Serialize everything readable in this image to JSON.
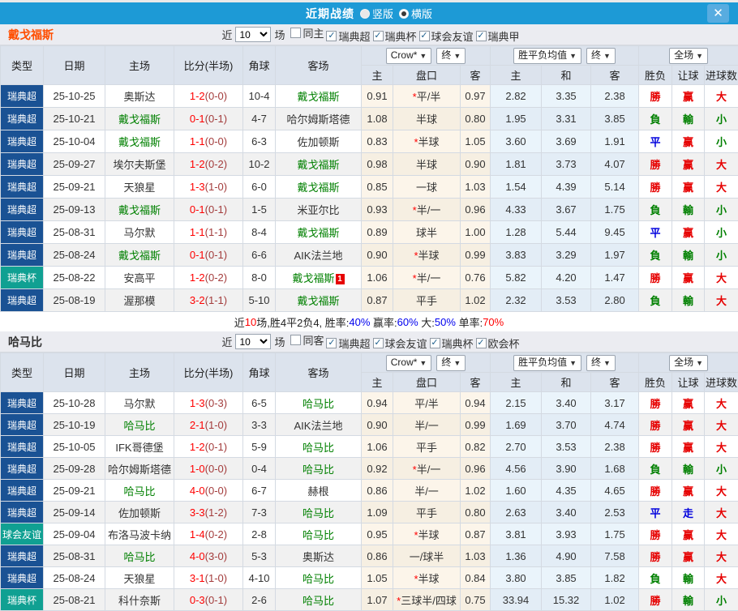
{
  "icons": {
    "close": "✕",
    "dropdown_arrow": "▼",
    "checkmark": "✓"
  },
  "header": {
    "title": "近期战绩",
    "view_options": [
      {
        "label": "竖版",
        "selected": false
      },
      {
        "label": "横版",
        "selected": true
      }
    ]
  },
  "table_header": {
    "main": [
      "类型",
      "日期",
      "主场",
      "比分(半场)",
      "角球",
      "客场"
    ],
    "sub": [
      "主",
      "盘口",
      "客",
      "主",
      "和",
      "客",
      "胜负",
      "让球",
      "进球数"
    ],
    "company": "Crow*",
    "final1": "终",
    "europe": "胜平负均值",
    "final2": "终",
    "scope": "全场"
  },
  "result_color_map": {
    "勝": "r",
    "赢": "r",
    "大": "r",
    "負": "g",
    "輸": "g",
    "小": "g",
    "平": "b",
    "走": "b"
  },
  "sections": [
    {
      "team": "戴戈福斯",
      "team_color": "#ff4e00",
      "near_label": "近",
      "count": "10",
      "games_label": "场",
      "filters": [
        {
          "label": "同主",
          "checked": false
        },
        {
          "label": "瑞典超",
          "checked": true
        },
        {
          "label": "瑞典杯",
          "checked": true
        },
        {
          "label": "球会友谊",
          "checked": true
        },
        {
          "label": "瑞典甲",
          "checked": true
        }
      ],
      "rows": [
        {
          "type": "瑞典超",
          "cup": false,
          "date": "25-10-25",
          "home": "奥斯达",
          "home_hl": false,
          "ft": "1-2",
          "ht": "0-0",
          "corners": "10-4",
          "away": "戴戈福斯",
          "away_hl": true,
          "badge": "",
          "asia": [
            "0.91",
            "*平/半",
            "0.97"
          ],
          "euro": [
            "2.82",
            "3.35",
            "2.38"
          ],
          "res": [
            "勝",
            "赢",
            "大"
          ]
        },
        {
          "type": "瑞典超",
          "cup": false,
          "date": "25-10-21",
          "home": "戴戈福斯",
          "home_hl": true,
          "ft": "0-1",
          "ht": "0-1",
          "corners": "4-7",
          "away": "哈尔姆斯塔德",
          "away_hl": false,
          "badge": "",
          "asia": [
            "1.08",
            "半球",
            "0.80"
          ],
          "euro": [
            "1.95",
            "3.31",
            "3.85"
          ],
          "res": [
            "負",
            "輸",
            "小"
          ]
        },
        {
          "type": "瑞典超",
          "cup": false,
          "date": "25-10-04",
          "home": "戴戈福斯",
          "home_hl": true,
          "ft": "1-1",
          "ht": "0-0",
          "corners": "6-3",
          "away": "佐加顿斯",
          "away_hl": false,
          "badge": "",
          "asia": [
            "0.83",
            "*半球",
            "1.05"
          ],
          "euro": [
            "3.60",
            "3.69",
            "1.91"
          ],
          "res": [
            "平",
            "赢",
            "小"
          ]
        },
        {
          "type": "瑞典超",
          "cup": false,
          "date": "25-09-27",
          "home": "埃尔夫斯堡",
          "home_hl": false,
          "ft": "1-2",
          "ht": "0-2",
          "corners": "10-2",
          "away": "戴戈福斯",
          "away_hl": true,
          "badge": "",
          "asia": [
            "0.98",
            "半球",
            "0.90"
          ],
          "euro": [
            "1.81",
            "3.73",
            "4.07"
          ],
          "res": [
            "勝",
            "赢",
            "大"
          ]
        },
        {
          "type": "瑞典超",
          "cup": false,
          "date": "25-09-21",
          "home": "天狼星",
          "home_hl": false,
          "ft": "1-3",
          "ht": "1-0",
          "corners": "6-0",
          "away": "戴戈福斯",
          "away_hl": true,
          "badge": "",
          "asia": [
            "0.85",
            "一球",
            "1.03"
          ],
          "euro": [
            "1.54",
            "4.39",
            "5.14"
          ],
          "res": [
            "勝",
            "赢",
            "大"
          ]
        },
        {
          "type": "瑞典超",
          "cup": false,
          "date": "25-09-13",
          "home": "戴戈福斯",
          "home_hl": true,
          "ft": "0-1",
          "ht": "0-1",
          "corners": "1-5",
          "away": "米亚尔比",
          "away_hl": false,
          "badge": "",
          "asia": [
            "0.93",
            "*半/一",
            "0.96"
          ],
          "euro": [
            "4.33",
            "3.67",
            "1.75"
          ],
          "res": [
            "負",
            "輸",
            "小"
          ]
        },
        {
          "type": "瑞典超",
          "cup": false,
          "date": "25-08-31",
          "home": "马尔默",
          "home_hl": false,
          "ft": "1-1",
          "ht": "1-1",
          "corners": "8-4",
          "away": "戴戈福斯",
          "away_hl": true,
          "badge": "",
          "asia": [
            "0.89",
            "球半",
            "1.00"
          ],
          "euro": [
            "1.28",
            "5.44",
            "9.45"
          ],
          "res": [
            "平",
            "赢",
            "小"
          ]
        },
        {
          "type": "瑞典超",
          "cup": false,
          "date": "25-08-24",
          "home": "戴戈福斯",
          "home_hl": true,
          "ft": "0-1",
          "ht": "0-1",
          "corners": "6-6",
          "away": "AIK法兰地",
          "away_hl": false,
          "badge": "",
          "asia": [
            "0.90",
            "*半球",
            "0.99"
          ],
          "euro": [
            "3.83",
            "3.29",
            "1.97"
          ],
          "res": [
            "負",
            "輸",
            "小"
          ]
        },
        {
          "type": "瑞典杯",
          "cup": true,
          "date": "25-08-22",
          "home": "安高平",
          "home_hl": false,
          "ft": "1-2",
          "ht": "0-2",
          "corners": "8-0",
          "away": "戴戈福斯",
          "away_hl": true,
          "badge": "1",
          "asia": [
            "1.06",
            "*半/一",
            "0.76"
          ],
          "euro": [
            "5.82",
            "4.20",
            "1.47"
          ],
          "res": [
            "勝",
            "赢",
            "大"
          ]
        },
        {
          "type": "瑞典超",
          "cup": false,
          "date": "25-08-19",
          "home": "渥那模",
          "home_hl": false,
          "ft": "3-2",
          "ht": "1-1",
          "corners": "5-10",
          "away": "戴戈福斯",
          "away_hl": true,
          "badge": "",
          "asia": [
            "0.87",
            "平手",
            "1.02"
          ],
          "euro": [
            "2.32",
            "3.53",
            "2.80"
          ],
          "res": [
            "負",
            "輸",
            "大"
          ]
        }
      ],
      "summary": [
        {
          "text": "近",
          "color": "black"
        },
        {
          "text": "10",
          "color": "red"
        },
        {
          "text": "场,胜4平2负4, 胜率:",
          "color": "black"
        },
        {
          "text": "40%",
          "color": "blue"
        },
        {
          "text": " 赢率:",
          "color": "black"
        },
        {
          "text": "60%",
          "color": "blue"
        },
        {
          "text": " 大:",
          "color": "black"
        },
        {
          "text": "50%",
          "color": "blue"
        },
        {
          "text": " 单率:",
          "color": "black"
        },
        {
          "text": "70%",
          "color": "red"
        }
      ]
    },
    {
      "team": "哈马比",
      "team_color": "#333333",
      "near_label": "近",
      "count": "10",
      "games_label": "场",
      "filters": [
        {
          "label": "同客",
          "checked": false
        },
        {
          "label": "瑞典超",
          "checked": true
        },
        {
          "label": "球会友谊",
          "checked": true
        },
        {
          "label": "瑞典杯",
          "checked": true
        },
        {
          "label": "欧会杯",
          "checked": true
        }
      ],
      "rows": [
        {
          "type": "瑞典超",
          "cup": false,
          "date": "25-10-28",
          "home": "马尔默",
          "home_hl": false,
          "ft": "1-3",
          "ht": "0-3",
          "corners": "6-5",
          "away": "哈马比",
          "away_hl": true,
          "badge": "",
          "asia": [
            "0.94",
            "平/半",
            "0.94"
          ],
          "euro": [
            "2.15",
            "3.40",
            "3.17"
          ],
          "res": [
            "勝",
            "赢",
            "大"
          ]
        },
        {
          "type": "瑞典超",
          "cup": false,
          "date": "25-10-19",
          "home": "哈马比",
          "home_hl": true,
          "ft": "2-1",
          "ht": "1-0",
          "corners": "3-3",
          "away": "AIK法兰地",
          "away_hl": false,
          "badge": "",
          "asia": [
            "0.90",
            "半/一",
            "0.99"
          ],
          "euro": [
            "1.69",
            "3.70",
            "4.74"
          ],
          "res": [
            "勝",
            "赢",
            "大"
          ]
        },
        {
          "type": "瑞典超",
          "cup": false,
          "date": "25-10-05",
          "home": "IFK哥德堡",
          "home_hl": false,
          "ft": "1-2",
          "ht": "0-1",
          "corners": "5-9",
          "away": "哈马比",
          "away_hl": true,
          "badge": "",
          "asia": [
            "1.06",
            "平手",
            "0.82"
          ],
          "euro": [
            "2.70",
            "3.53",
            "2.38"
          ],
          "res": [
            "勝",
            "赢",
            "大"
          ]
        },
        {
          "type": "瑞典超",
          "cup": false,
          "date": "25-09-28",
          "home": "哈尔姆斯塔德",
          "home_hl": false,
          "ft": "1-0",
          "ht": "0-0",
          "corners": "0-4",
          "away": "哈马比",
          "away_hl": true,
          "badge": "",
          "asia": [
            "0.92",
            "*半/一",
            "0.96"
          ],
          "euro": [
            "4.56",
            "3.90",
            "1.68"
          ],
          "res": [
            "負",
            "輸",
            "小"
          ]
        },
        {
          "type": "瑞典超",
          "cup": false,
          "date": "25-09-21",
          "home": "哈马比",
          "home_hl": true,
          "ft": "4-0",
          "ht": "0-0",
          "corners": "6-7",
          "away": "赫根",
          "away_hl": false,
          "badge": "",
          "asia": [
            "0.86",
            "半/一",
            "1.02"
          ],
          "euro": [
            "1.60",
            "4.35",
            "4.65"
          ],
          "res": [
            "勝",
            "赢",
            "大"
          ]
        },
        {
          "type": "瑞典超",
          "cup": false,
          "date": "25-09-14",
          "home": "佐加顿斯",
          "home_hl": false,
          "ft": "3-3",
          "ht": "1-2",
          "corners": "7-3",
          "away": "哈马比",
          "away_hl": true,
          "badge": "",
          "asia": [
            "1.09",
            "平手",
            "0.80"
          ],
          "euro": [
            "2.63",
            "3.40",
            "2.53"
          ],
          "res": [
            "平",
            "走",
            "大"
          ]
        },
        {
          "type": "球会友谊",
          "cup": true,
          "date": "25-09-04",
          "home": "布洛马波卡纳",
          "home_hl": false,
          "ft": "1-4",
          "ht": "0-2",
          "corners": "2-8",
          "away": "哈马比",
          "away_hl": true,
          "badge": "",
          "asia": [
            "0.95",
            "*半球",
            "0.87"
          ],
          "euro": [
            "3.81",
            "3.93",
            "1.75"
          ],
          "res": [
            "勝",
            "赢",
            "大"
          ]
        },
        {
          "type": "瑞典超",
          "cup": false,
          "date": "25-08-31",
          "home": "哈马比",
          "home_hl": true,
          "ft": "4-0",
          "ht": "3-0",
          "corners": "5-3",
          "away": "奥斯达",
          "away_hl": false,
          "badge": "",
          "asia": [
            "0.86",
            "一/球半",
            "1.03"
          ],
          "euro": [
            "1.36",
            "4.90",
            "7.58"
          ],
          "res": [
            "勝",
            "赢",
            "大"
          ]
        },
        {
          "type": "瑞典超",
          "cup": false,
          "date": "25-08-24",
          "home": "天狼星",
          "home_hl": false,
          "ft": "3-1",
          "ht": "1-0",
          "corners": "4-10",
          "away": "哈马比",
          "away_hl": true,
          "badge": "",
          "asia": [
            "1.05",
            "*半球",
            "0.84"
          ],
          "euro": [
            "3.80",
            "3.85",
            "1.82"
          ],
          "res": [
            "負",
            "輸",
            "大"
          ]
        },
        {
          "type": "瑞典杯",
          "cup": true,
          "date": "25-08-21",
          "home": "科什奈斯",
          "home_hl": false,
          "ft": "0-3",
          "ht": "0-1",
          "corners": "2-6",
          "away": "哈马比",
          "away_hl": true,
          "badge": "",
          "asia": [
            "1.07",
            "*三球半/四球",
            "0.75"
          ],
          "euro": [
            "33.94",
            "15.32",
            "1.02"
          ],
          "res": [
            "勝",
            "輸",
            "小"
          ]
        }
      ],
      "summary": null
    }
  ]
}
